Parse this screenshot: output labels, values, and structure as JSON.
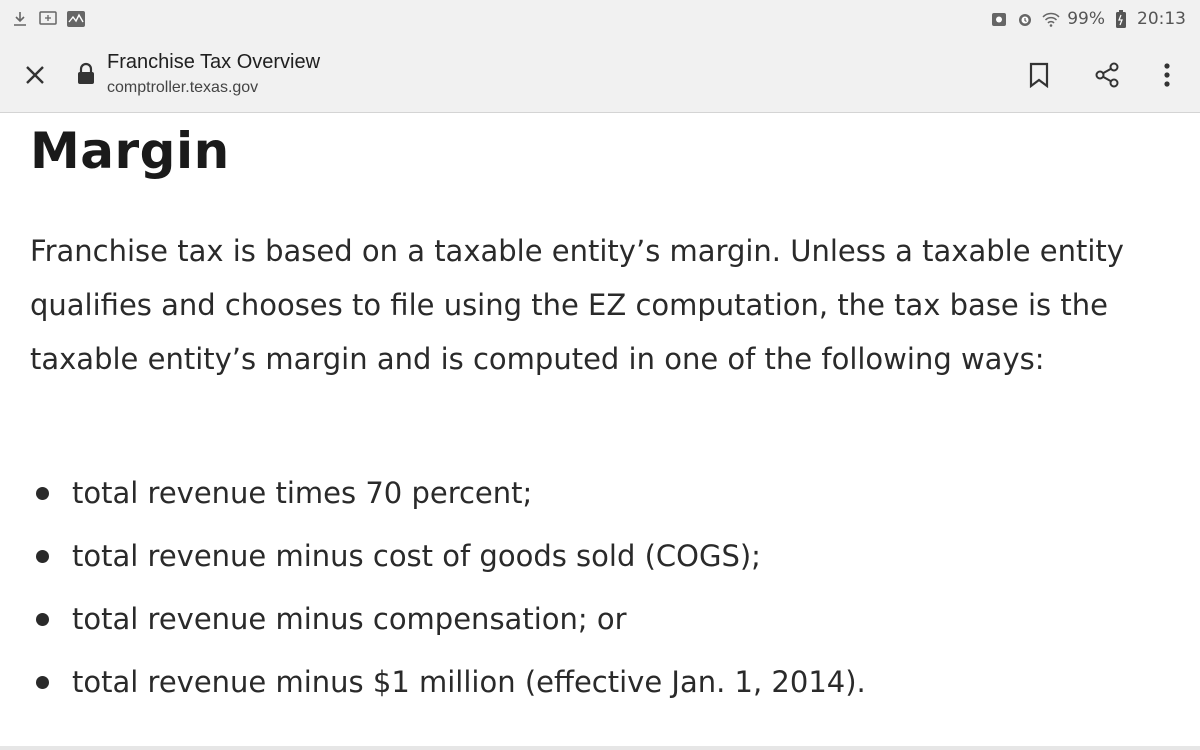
{
  "status_bar": {
    "left_icons": [
      "download-icon",
      "cast-icon",
      "activity-icon"
    ],
    "battery": "99%",
    "time": "20:13"
  },
  "toolbar": {
    "title": "Franchise Tax Overview",
    "url": "comptroller.texas.gov"
  },
  "content": {
    "heading": "Margin",
    "paragraph": "Franchise tax is based on a taxable entity’s margin. Unless a taxable entity qualifies and chooses to file using the EZ computation, the tax base is the taxable entity’s margin and is computed in one of the following ways:",
    "bullets": [
      "total revenue times 70 percent;",
      "total revenue minus cost of goods sold (COGS);",
      "total revenue minus compensation; or",
      "total revenue minus $1 million (effective Jan. 1, 2014)."
    ]
  }
}
